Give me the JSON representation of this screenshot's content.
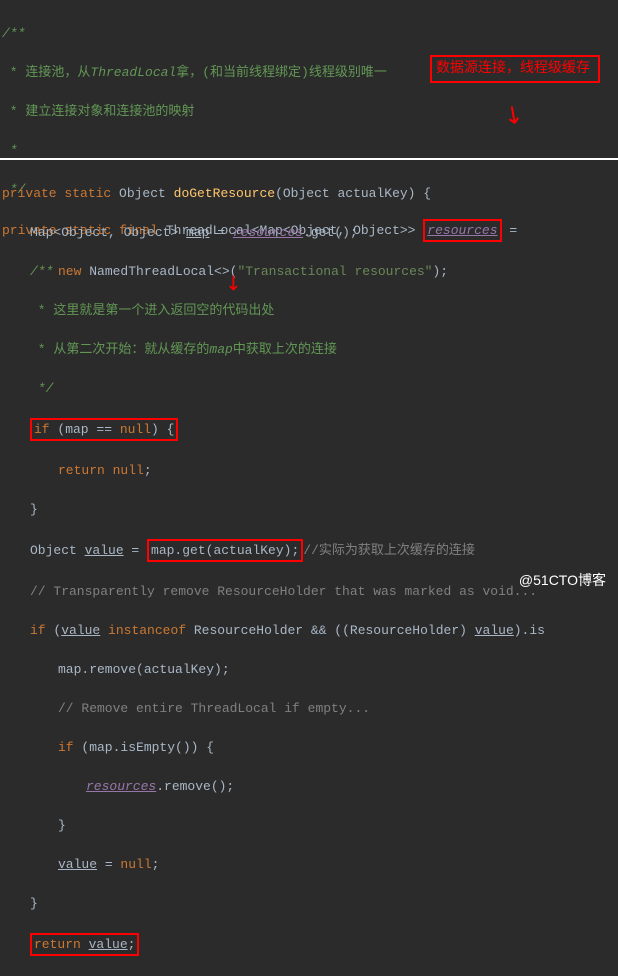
{
  "block1": {
    "l1": "/**",
    "l2_a": " * 连接池，从",
    "l2_b": "ThreadLocal",
    "l2_c": "拿，(和当前线程绑定)线程级别唯一",
    "l3": " * 建立连接对象和连接池的映射",
    "l4": " *",
    "l5": " */",
    "l6_private": "private ",
    "l6_static": "static ",
    "l6_final": "final ",
    "l6_type": "ThreadLocal<Map<Object, Object>> ",
    "l6_field": "resources",
    "l6_eq": " =",
    "l7_new": "new ",
    "l7_type": "NamedThreadLocal<>(",
    "l7_str": "\"Transactional resources\"",
    "l7_end": ");"
  },
  "annotation1": "数据源连接，线程级缓存",
  "block2": {
    "l1_private": "private ",
    "l1_static": "static ",
    "l1_obj": "Object ",
    "l1_method": "doGetResource",
    "l1_params": "(Object actualKey) {",
    "l2_type": "Map<Object, Object> ",
    "l2_var": "map",
    "l2_eq": " = ",
    "l2_field": "resources",
    "l2_call": ".get();",
    "l3": "/**",
    "l4": " * 这里就是第一个进入返回空的代码出处",
    "l5_a": " * 从第二次开始：就从缓存的",
    "l5_b": "map",
    "l5_c": "中获取上次的连接",
    "l6": " */",
    "l7_if": "if ",
    "l7_cond": "(map == ",
    "l7_null": "null",
    "l7_brace": ") {",
    "l8_return": "return ",
    "l8_null": "null",
    "l8_semi": ";",
    "l9": "}",
    "l10_type": "Object ",
    "l10_var": "value",
    "l10_eq": " = ",
    "l10_call": "map.get(actualKey);",
    "l10_comment": "//实际为获取上次缓存的连接",
    "l11": "// Transparently remove ResourceHolder that was marked as void...",
    "l12_if": "if ",
    "l12_a": "(",
    "l12_val": "value",
    "l12_b": " ",
    "l12_inst": "instanceof ",
    "l12_c": "ResourceHolder && ((ResourceHolder) ",
    "l12_val2": "value",
    "l12_d": ").is",
    "l13": "map.remove(actualKey);",
    "l14": "// Remove entire ThreadLocal if empty...",
    "l15_if": "if ",
    "l15_cond": "(map.isEmpty()) {",
    "l16_field": "resources",
    "l16_call": ".remove();",
    "l17": "}",
    "l18_var": "value",
    "l18_eq": " = ",
    "l18_null": "null",
    "l18_semi": ";",
    "l19": "}",
    "l20_return": "return ",
    "l20_var": "value",
    "l20_semi": ";"
  },
  "watermark": "@51CTO博客"
}
